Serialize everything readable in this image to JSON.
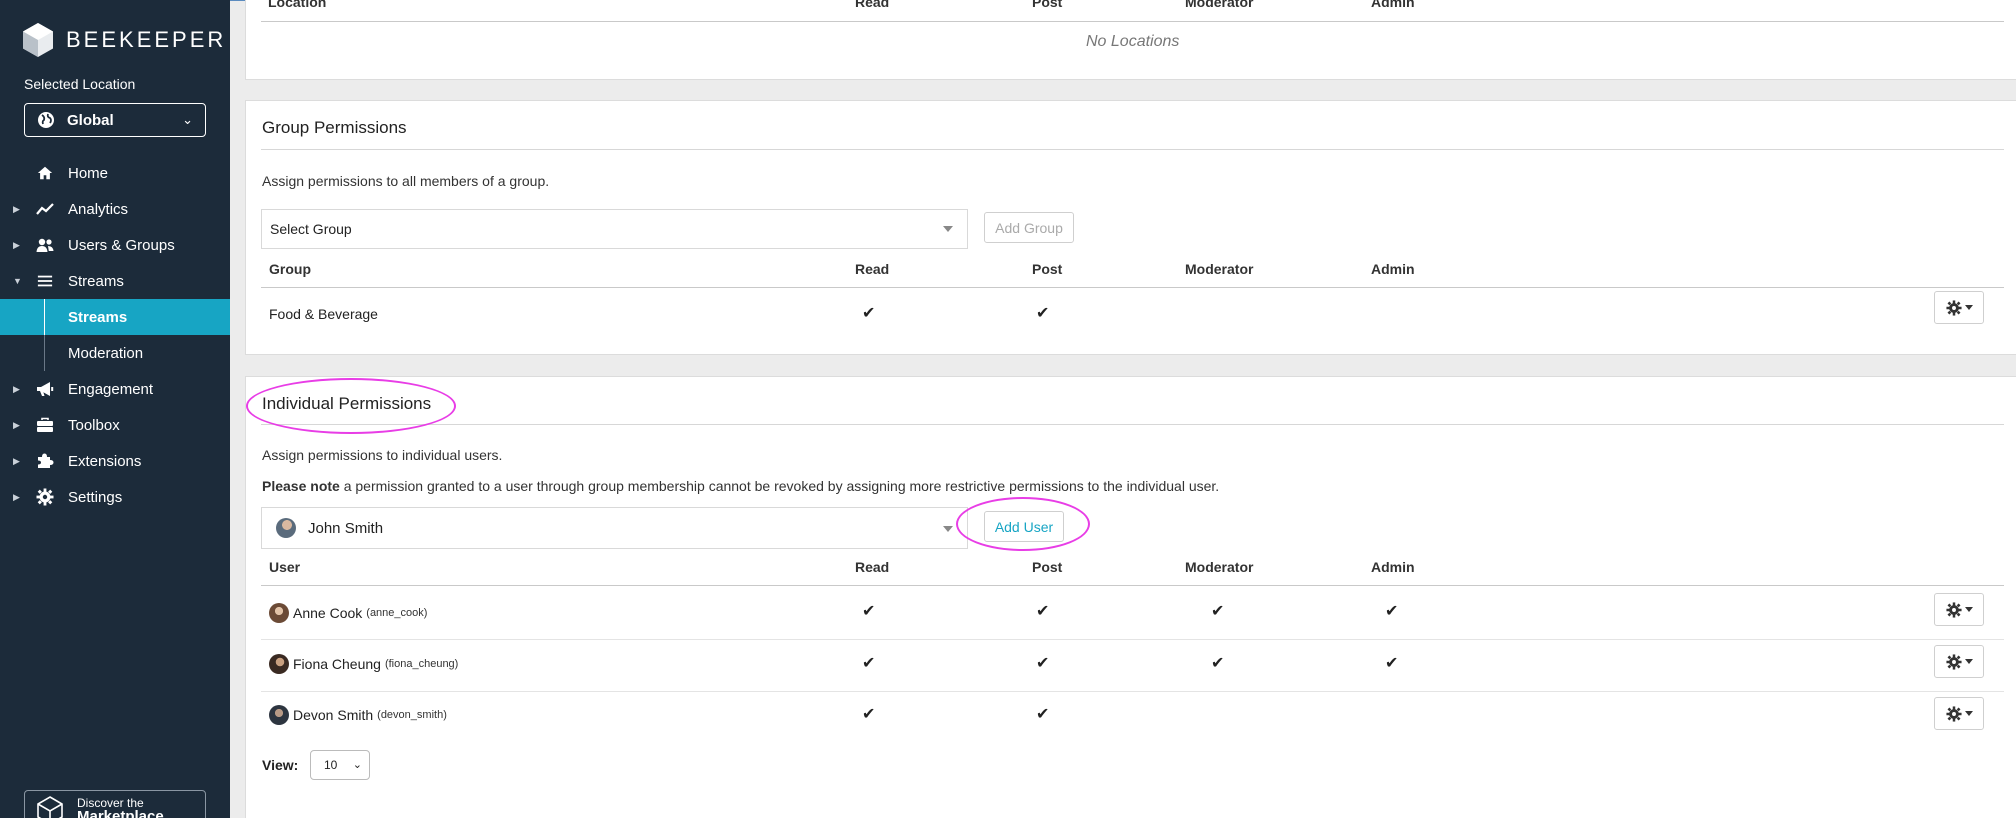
{
  "brand": {
    "name": "BEEKEEPER"
  },
  "sidebar": {
    "selected_location_label": "Selected Location",
    "location_value": "Global",
    "items": [
      {
        "label": "Home",
        "icon": "home-icon"
      },
      {
        "label": "Analytics",
        "icon": "analytics-icon"
      },
      {
        "label": "Users & Groups",
        "icon": "users-icon"
      },
      {
        "label": "Streams",
        "icon": "streams-icon"
      },
      {
        "label": "Engagement",
        "icon": "megaphone-icon"
      },
      {
        "label": "Toolbox",
        "icon": "toolbox-icon"
      },
      {
        "label": "Extensions",
        "icon": "puzzle-icon"
      },
      {
        "label": "Settings",
        "icon": "gear-icon"
      }
    ],
    "sub_items": [
      {
        "label": "Streams",
        "active": true
      },
      {
        "label": "Moderation",
        "active": false
      }
    ],
    "marketplace": {
      "line1": "Discover the",
      "line2": "Marketplace"
    },
    "colors": {
      "background": "#1c2b3a",
      "active": "#17a5c4"
    }
  },
  "location_permissions": {
    "headers": {
      "location": "Location",
      "read": "Read",
      "post": "Post",
      "moderator": "Moderator",
      "admin": "Admin"
    },
    "empty_text": "No Locations"
  },
  "group_permissions": {
    "title": "Group Permissions",
    "description": "Assign permissions to all members of a group.",
    "select_placeholder": "Select Group",
    "add_button": "Add Group",
    "headers": {
      "group": "Group",
      "read": "Read",
      "post": "Post",
      "moderator": "Moderator",
      "admin": "Admin"
    },
    "rows": [
      {
        "name": "Food & Beverage",
        "read": true,
        "post": true,
        "moderator": false,
        "admin": false
      }
    ]
  },
  "individual_permissions": {
    "title": "Individual Permissions",
    "description": "Assign permissions to individual users.",
    "note_bold": "Please note",
    "note_rest": " a permission granted to a user through group membership cannot be revoked by assigning more restrictive permissions to the individual user.",
    "selected_user": "John Smith",
    "add_button": "Add User",
    "headers": {
      "user": "User",
      "read": "Read",
      "post": "Post",
      "moderator": "Moderator",
      "admin": "Admin"
    },
    "rows": [
      {
        "name": "Anne Cook",
        "handle": "(anne_cook)",
        "read": true,
        "post": true,
        "moderator": true,
        "admin": true
      },
      {
        "name": "Fiona Cheung",
        "handle": "(fiona_cheung)",
        "read": true,
        "post": true,
        "moderator": true,
        "admin": true
      },
      {
        "name": "Devon Smith",
        "handle": "(devon_smith)",
        "read": true,
        "post": true,
        "moderator": false,
        "admin": false
      }
    ],
    "view_label": "View:",
    "view_value": "10"
  },
  "check_glyph": "✔",
  "annotation_color": "#e83de6"
}
